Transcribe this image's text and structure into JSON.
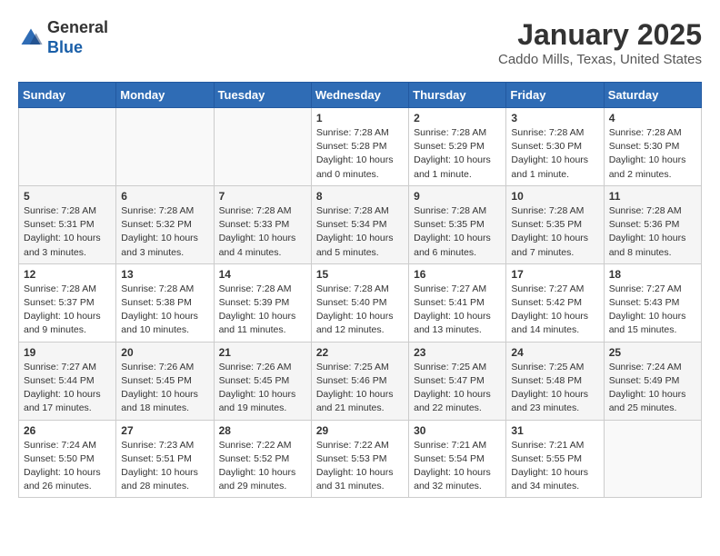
{
  "header": {
    "logo": {
      "line1": "General",
      "line2": "Blue"
    },
    "title": "January 2025",
    "subtitle": "Caddo Mills, Texas, United States"
  },
  "calendar": {
    "days_of_week": [
      "Sunday",
      "Monday",
      "Tuesday",
      "Wednesday",
      "Thursday",
      "Friday",
      "Saturday"
    ],
    "weeks": [
      [
        {
          "day": "",
          "info": ""
        },
        {
          "day": "",
          "info": ""
        },
        {
          "day": "",
          "info": ""
        },
        {
          "day": "1",
          "info": "Sunrise: 7:28 AM\nSunset: 5:28 PM\nDaylight: 10 hours\nand 0 minutes."
        },
        {
          "day": "2",
          "info": "Sunrise: 7:28 AM\nSunset: 5:29 PM\nDaylight: 10 hours\nand 1 minute."
        },
        {
          "day": "3",
          "info": "Sunrise: 7:28 AM\nSunset: 5:30 PM\nDaylight: 10 hours\nand 1 minute."
        },
        {
          "day": "4",
          "info": "Sunrise: 7:28 AM\nSunset: 5:30 PM\nDaylight: 10 hours\nand 2 minutes."
        }
      ],
      [
        {
          "day": "5",
          "info": "Sunrise: 7:28 AM\nSunset: 5:31 PM\nDaylight: 10 hours\nand 3 minutes."
        },
        {
          "day": "6",
          "info": "Sunrise: 7:28 AM\nSunset: 5:32 PM\nDaylight: 10 hours\nand 3 minutes."
        },
        {
          "day": "7",
          "info": "Sunrise: 7:28 AM\nSunset: 5:33 PM\nDaylight: 10 hours\nand 4 minutes."
        },
        {
          "day": "8",
          "info": "Sunrise: 7:28 AM\nSunset: 5:34 PM\nDaylight: 10 hours\nand 5 minutes."
        },
        {
          "day": "9",
          "info": "Sunrise: 7:28 AM\nSunset: 5:35 PM\nDaylight: 10 hours\nand 6 minutes."
        },
        {
          "day": "10",
          "info": "Sunrise: 7:28 AM\nSunset: 5:35 PM\nDaylight: 10 hours\nand 7 minutes."
        },
        {
          "day": "11",
          "info": "Sunrise: 7:28 AM\nSunset: 5:36 PM\nDaylight: 10 hours\nand 8 minutes."
        }
      ],
      [
        {
          "day": "12",
          "info": "Sunrise: 7:28 AM\nSunset: 5:37 PM\nDaylight: 10 hours\nand 9 minutes."
        },
        {
          "day": "13",
          "info": "Sunrise: 7:28 AM\nSunset: 5:38 PM\nDaylight: 10 hours\nand 10 minutes."
        },
        {
          "day": "14",
          "info": "Sunrise: 7:28 AM\nSunset: 5:39 PM\nDaylight: 10 hours\nand 11 minutes."
        },
        {
          "day": "15",
          "info": "Sunrise: 7:28 AM\nSunset: 5:40 PM\nDaylight: 10 hours\nand 12 minutes."
        },
        {
          "day": "16",
          "info": "Sunrise: 7:27 AM\nSunset: 5:41 PM\nDaylight: 10 hours\nand 13 minutes."
        },
        {
          "day": "17",
          "info": "Sunrise: 7:27 AM\nSunset: 5:42 PM\nDaylight: 10 hours\nand 14 minutes."
        },
        {
          "day": "18",
          "info": "Sunrise: 7:27 AM\nSunset: 5:43 PM\nDaylight: 10 hours\nand 15 minutes."
        }
      ],
      [
        {
          "day": "19",
          "info": "Sunrise: 7:27 AM\nSunset: 5:44 PM\nDaylight: 10 hours\nand 17 minutes."
        },
        {
          "day": "20",
          "info": "Sunrise: 7:26 AM\nSunset: 5:45 PM\nDaylight: 10 hours\nand 18 minutes."
        },
        {
          "day": "21",
          "info": "Sunrise: 7:26 AM\nSunset: 5:45 PM\nDaylight: 10 hours\nand 19 minutes."
        },
        {
          "day": "22",
          "info": "Sunrise: 7:25 AM\nSunset: 5:46 PM\nDaylight: 10 hours\nand 21 minutes."
        },
        {
          "day": "23",
          "info": "Sunrise: 7:25 AM\nSunset: 5:47 PM\nDaylight: 10 hours\nand 22 minutes."
        },
        {
          "day": "24",
          "info": "Sunrise: 7:25 AM\nSunset: 5:48 PM\nDaylight: 10 hours\nand 23 minutes."
        },
        {
          "day": "25",
          "info": "Sunrise: 7:24 AM\nSunset: 5:49 PM\nDaylight: 10 hours\nand 25 minutes."
        }
      ],
      [
        {
          "day": "26",
          "info": "Sunrise: 7:24 AM\nSunset: 5:50 PM\nDaylight: 10 hours\nand 26 minutes."
        },
        {
          "day": "27",
          "info": "Sunrise: 7:23 AM\nSunset: 5:51 PM\nDaylight: 10 hours\nand 28 minutes."
        },
        {
          "day": "28",
          "info": "Sunrise: 7:22 AM\nSunset: 5:52 PM\nDaylight: 10 hours\nand 29 minutes."
        },
        {
          "day": "29",
          "info": "Sunrise: 7:22 AM\nSunset: 5:53 PM\nDaylight: 10 hours\nand 31 minutes."
        },
        {
          "day": "30",
          "info": "Sunrise: 7:21 AM\nSunset: 5:54 PM\nDaylight: 10 hours\nand 32 minutes."
        },
        {
          "day": "31",
          "info": "Sunrise: 7:21 AM\nSunset: 5:55 PM\nDaylight: 10 hours\nand 34 minutes."
        },
        {
          "day": "",
          "info": ""
        }
      ]
    ]
  }
}
